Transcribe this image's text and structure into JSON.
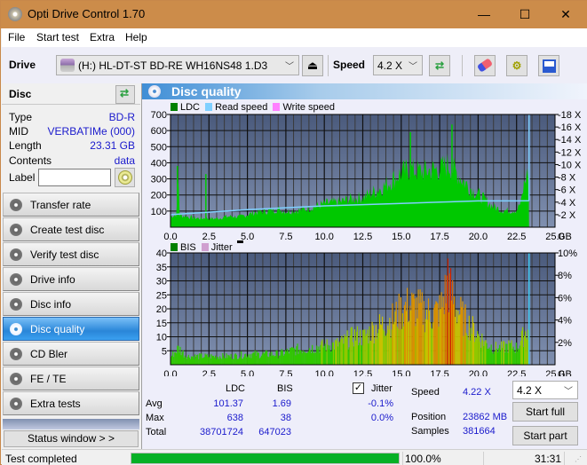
{
  "window": {
    "title": "Opti Drive Control 1.70",
    "minimize": "—",
    "maximize": "☐",
    "close": "✕"
  },
  "menu": [
    "File",
    "Start test",
    "Extra",
    "Help"
  ],
  "toolbar": {
    "drive_label": "Drive",
    "drive_value": "(H:)  HL-DT-ST BD-RE  WH16NS48 1.D3",
    "speed_label": "Speed",
    "speed_value": "4.2 X",
    "icons": [
      "eject-icon",
      "refresh-icon",
      "erase-icon",
      "settings-icon",
      "save-icon"
    ]
  },
  "disc": {
    "title": "Disc",
    "fields": [
      {
        "key": "Type",
        "value": "BD-R"
      },
      {
        "key": "MID",
        "value": "VERBATIMe (000)"
      },
      {
        "key": "Length",
        "value": "23.31 GB"
      },
      {
        "key": "Contents",
        "value": "data"
      }
    ],
    "label_key": "Label",
    "label_value": ""
  },
  "nav": {
    "items": [
      {
        "label": "Transfer rate",
        "active": false
      },
      {
        "label": "Create test disc",
        "active": false
      },
      {
        "label": "Verify test disc",
        "active": false
      },
      {
        "label": "Drive info",
        "active": false
      },
      {
        "label": "Disc info",
        "active": false
      },
      {
        "label": "Disc quality",
        "active": true
      },
      {
        "label": "CD Bler",
        "active": false
      },
      {
        "label": "FE / TE",
        "active": false
      },
      {
        "label": "Extra tests",
        "active": false
      }
    ],
    "status_window": "Status window > >"
  },
  "panel": {
    "title": "Disc quality"
  },
  "colors": {
    "ldc": "#00c800",
    "ldc_legend": "#008000",
    "read_speed": "#80d0ff",
    "write_speed": "#ff80ff",
    "bis_legend": "#008000",
    "jitter_legend": "#d0a0d0",
    "plot_bg_top": "#4a5a7c",
    "plot_bg_bottom": "#8090b0",
    "accent": "#3f8ed6",
    "progress": "#06b025"
  },
  "chart_data": [
    {
      "type": "area",
      "title": "LDC",
      "legend": [
        "LDC",
        "Read speed",
        "Write speed"
      ],
      "xlabel": "GB",
      "xlim": [
        0,
        25
      ],
      "x_ticks": [
        "0.0",
        "2.5",
        "5.0",
        "7.5",
        "10.0",
        "12.5",
        "15.0",
        "17.5",
        "20.0",
        "22.5",
        "25.0"
      ],
      "ylim_left": [
        0,
        700
      ],
      "y_ticks_left": [
        "100",
        "200",
        "300",
        "400",
        "500",
        "600",
        "700"
      ],
      "ylim_right": [
        0,
        18
      ],
      "y_ticks_right": [
        "2 X",
        "4 X",
        "6 X",
        "8 X",
        "10 X",
        "12 X",
        "14 X",
        "16 X",
        "18 X"
      ],
      "grid": true,
      "series": [
        {
          "name": "LDC",
          "x": [
            0.0,
            0.4,
            0.5,
            0.6,
            1.0,
            1.5,
            2.0,
            2.3,
            2.5,
            3.0,
            3.5,
            4.0,
            4.5,
            5.0,
            5.5,
            6.0,
            6.5,
            7.0,
            7.5,
            8.0,
            8.5,
            9.0,
            9.5,
            10.0,
            10.5,
            11.0,
            11.5,
            12.0,
            12.5,
            13.0,
            13.5,
            14.0,
            14.5,
            15.0,
            15.5,
            16.0,
            16.5,
            17.0,
            17.5,
            18.0,
            18.5,
            19.0,
            19.5,
            20.0,
            20.5,
            21.0,
            21.5,
            22.0,
            22.5,
            22.8,
            23.0,
            23.31
          ],
          "values": [
            70,
            80,
            370,
            75,
            70,
            60,
            55,
            60,
            55,
            55,
            65,
            70,
            65,
            80,
            95,
            100,
            105,
            115,
            100,
            105,
            110,
            120,
            135,
            150,
            155,
            160,
            175,
            185,
            190,
            215,
            240,
            270,
            310,
            345,
            370,
            360,
            355,
            365,
            370,
            400,
            360,
            300,
            250,
            210,
            170,
            130,
            110,
            105,
            110,
            160,
            280,
            380
          ]
        },
        {
          "name": "Read speed",
          "unit": "X",
          "x": [
            0.0,
            2.5,
            5.0,
            7.5,
            10.0,
            12.5,
            15.0,
            17.5,
            20.0,
            22.5,
            23.31
          ],
          "values": [
            2.0,
            2.4,
            2.8,
            3.1,
            3.4,
            3.6,
            3.8,
            4.0,
            4.2,
            4.2,
            4.22
          ]
        }
      ],
      "notable_spikes": [
        {
          "x": 0.45,
          "value": 380
        },
        {
          "x": 2.3,
          "value": 330
        },
        {
          "x": 15.6,
          "value": 590
        },
        {
          "x": 18.3,
          "value": 638
        }
      ]
    },
    {
      "type": "bar",
      "title": "BIS / Jitter",
      "legend": [
        "BIS",
        "Jitter"
      ],
      "xlabel": "GB",
      "xlim": [
        0,
        25
      ],
      "x_ticks": [
        "0.0",
        "2.5",
        "5.0",
        "7.5",
        "10.0",
        "12.5",
        "15.0",
        "17.5",
        "20.0",
        "22.5",
        "25.0"
      ],
      "ylim_left": [
        0,
        40
      ],
      "y_ticks_left": [
        "5",
        "10",
        "15",
        "20",
        "25",
        "30",
        "35",
        "40"
      ],
      "ylim_right": [
        0,
        10
      ],
      "y_ticks_right": [
        "2%",
        "4%",
        "6%",
        "8%",
        "10%"
      ],
      "grid": true,
      "series": [
        {
          "name": "BIS",
          "x": [
            0.0,
            0.5,
            1.0,
            2.0,
            3.0,
            4.0,
            5.0,
            6.0,
            7.0,
            7.5,
            8.0,
            9.0,
            10.0,
            11.0,
            12.0,
            12.5,
            13.0,
            13.5,
            14.0,
            14.5,
            15.0,
            15.5,
            16.0,
            16.5,
            17.0,
            17.5,
            18.0,
            18.5,
            19.0,
            19.5,
            20.0,
            20.5,
            21.0,
            21.5,
            22.0,
            22.5,
            23.0,
            23.31
          ],
          "values": [
            4,
            8,
            4,
            4,
            4,
            4,
            5,
            5,
            5,
            6,
            7,
            8,
            9,
            10,
            14,
            13,
            16,
            18,
            20,
            22,
            26,
            28,
            27,
            25,
            24,
            26,
            38,
            28,
            22,
            18,
            14,
            10,
            8,
            8,
            9,
            8,
            15,
            18
          ]
        }
      ]
    }
  ],
  "stats": {
    "col_ldc": "LDC",
    "col_bis": "BIS",
    "rows": [
      {
        "label": "Avg",
        "ldc": "101.37",
        "bis": "1.69",
        "jitter": "-0.1%"
      },
      {
        "label": "Max",
        "ldc": "638",
        "bis": "38",
        "jitter": "0.0%"
      },
      {
        "label": "Total",
        "ldc": "38701724",
        "bis": "647023",
        "jitter": ""
      }
    ],
    "jitter_label": "Jitter",
    "jitter_checked": true,
    "speed_label": "Speed",
    "speed_value": "4.22 X",
    "position_label": "Position",
    "position_value": "23862 MB",
    "samples_label": "Samples",
    "samples_value": "381664",
    "speed_select": "4.2 X",
    "start_full": "Start full",
    "start_part": "Start part"
  },
  "statusbar": {
    "message": "Test completed",
    "progress": 1.0,
    "progress_text": "100.0%",
    "time": "31:31"
  }
}
